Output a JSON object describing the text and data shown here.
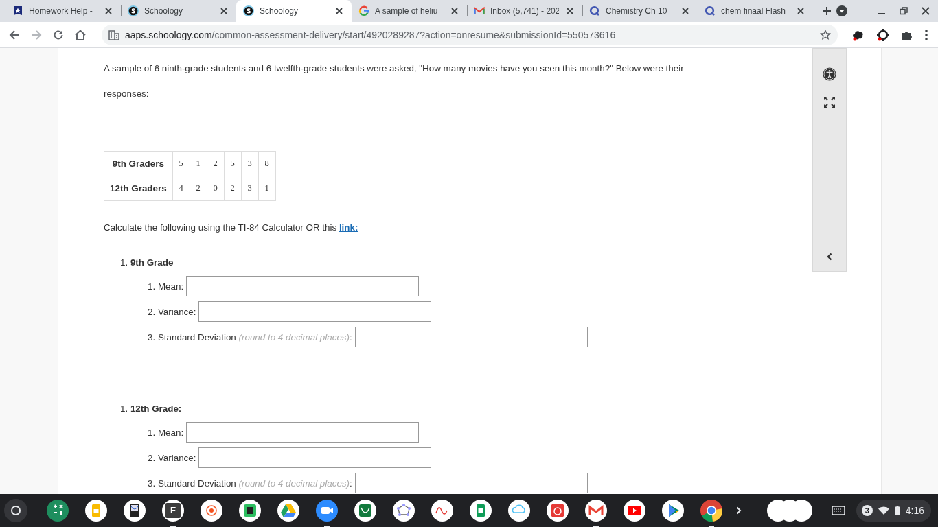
{
  "tabs": [
    {
      "title": "Homework Help - ",
      "kind": "shield",
      "selected": false
    },
    {
      "title": "Schoology",
      "kind": "s",
      "selected": false
    },
    {
      "title": "Schoology",
      "kind": "s",
      "selected": true
    },
    {
      "title": "A sample of heliu",
      "kind": "g",
      "selected": false
    },
    {
      "title": "Inbox (5,741) - 202",
      "kind": "m",
      "selected": false
    },
    {
      "title": "Chemistry Ch 10 ",
      "kind": "q",
      "selected": false
    },
    {
      "title": "chem finaal Flash",
      "kind": "q",
      "selected": false
    }
  ],
  "address": {
    "host": "aaps.schoology.com",
    "path": "/common-assessment-delivery/start/4920289287?action=onresume&submissionId=550573616"
  },
  "question": {
    "intro": "A sample of 6 ninth-grade students and 6 twelfth-grade students were asked, \"How many movies have you seen this month?\" Below were their responses:",
    "table": [
      {
        "label": "9th Graders",
        "values": [
          "5",
          "1",
          "2",
          "5",
          "3",
          "8"
        ]
      },
      {
        "label": "12th Graders",
        "values": [
          "4",
          "2",
          "0",
          "2",
          "3",
          "1"
        ]
      }
    ],
    "instruction": "Calculate the following using the TI-84 Calculator OR this",
    "link": "link:",
    "sections": [
      {
        "number": "1.",
        "title": "9th Grade",
        "fields": [
          {
            "number": "1.",
            "label": "Mean:"
          },
          {
            "number": "2.",
            "label": "Variance:"
          },
          {
            "number": "3.",
            "label": "Standard Deviation",
            "note": "(round to 4 decimal places)",
            "tail": ":"
          }
        ]
      },
      {
        "number": "1.",
        "title": "12th Grade:",
        "fields": [
          {
            "number": "1.",
            "label": "Mean:"
          },
          {
            "number": "2.",
            "label": "Variance:"
          },
          {
            "number": "3.",
            "label": "Standard Deviation",
            "note": "(round to 4 decimal places)",
            "tail": ":"
          }
        ]
      }
    ]
  },
  "shelf": {
    "apps": [
      {
        "kind": "calc",
        "running": false
      },
      {
        "kind": "slides",
        "running": false
      },
      {
        "kind": "graph",
        "running": false
      },
      {
        "kind": "tile",
        "label": "E",
        "running": true
      },
      {
        "kind": "target",
        "running": false
      },
      {
        "kind": "evernote",
        "running": false
      },
      {
        "kind": "drive",
        "running": false
      },
      {
        "kind": "zoom",
        "running": true
      },
      {
        "kind": "desmos",
        "running": false
      },
      {
        "kind": "geo",
        "running": false
      },
      {
        "kind": "wave",
        "running": false
      },
      {
        "kind": "sheets",
        "running": false
      },
      {
        "kind": "cloud",
        "running": false
      },
      {
        "kind": "bug",
        "running": false
      },
      {
        "kind": "gmail",
        "running": true
      },
      {
        "kind": "youtube",
        "running": false
      },
      {
        "kind": "play",
        "running": false
      },
      {
        "kind": "chrome",
        "running": true
      }
    ],
    "notifications": "3",
    "time": "4:16"
  }
}
